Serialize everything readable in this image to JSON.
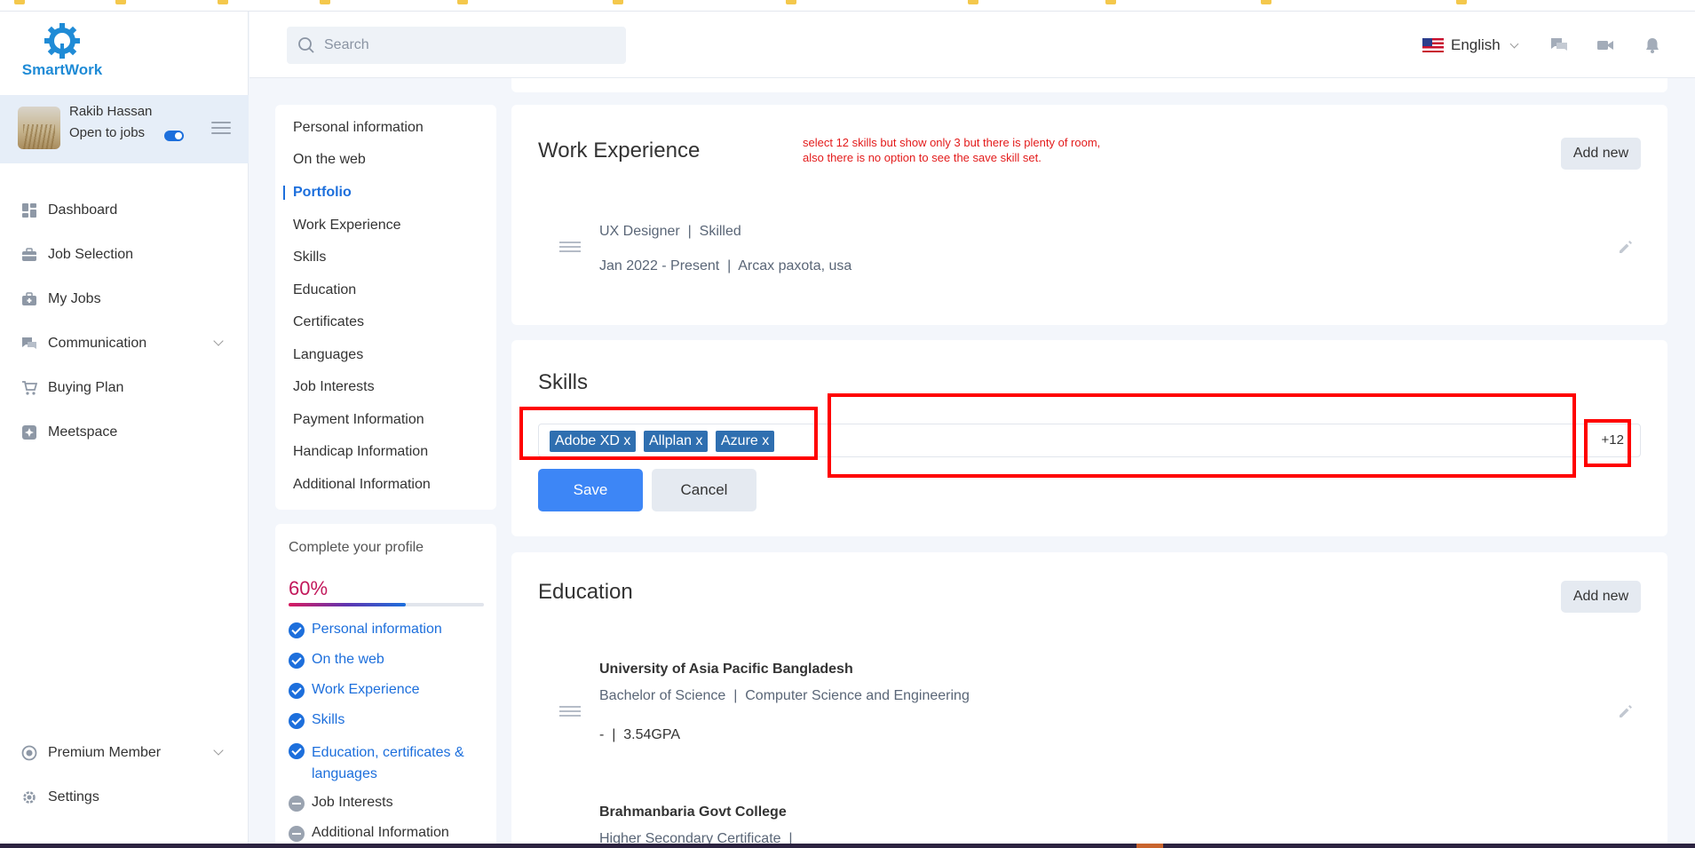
{
  "app": {
    "logo_text": "SmartWork",
    "brand_color": "#1f8bd6",
    "accent_color": "#1d6fdc"
  },
  "user": {
    "name": "Rakib Hassan",
    "status": "Open to jobs",
    "open_to_jobs": true
  },
  "sidebar": {
    "items": [
      {
        "label": "Dashboard",
        "icon": "dashboard-icon"
      },
      {
        "label": "Job Selection",
        "icon": "briefcase-icon"
      },
      {
        "label": "My Jobs",
        "icon": "jobs-bag-icon"
      },
      {
        "label": "Communication",
        "icon": "chat-icon"
      },
      {
        "label": "Buying Plan",
        "icon": "cart-icon"
      },
      {
        "label": "Meetspace",
        "icon": "meetspace-icon"
      }
    ],
    "bottom_items": [
      {
        "label": "Premium Member",
        "icon": "premium-icon"
      },
      {
        "label": "Settings",
        "icon": "gear-icon"
      }
    ]
  },
  "header": {
    "search_placeholder": "Search",
    "language": "English"
  },
  "section_nav": {
    "items": [
      "Personal information",
      "On the web",
      "Portfolio",
      "Work Experience",
      "Skills",
      "Education",
      "Certificates",
      "Languages",
      "Job Interests",
      "Payment Information",
      "Handicap Information",
      "Additional Information"
    ],
    "active": "Portfolio"
  },
  "profile_completion": {
    "title": "Complete your profile",
    "percent_label": "60%",
    "percent": 60,
    "items": [
      {
        "label": "Personal information",
        "done": true
      },
      {
        "label": "On the web",
        "done": true
      },
      {
        "label": "Work Experience",
        "done": true
      },
      {
        "label": "Skills",
        "done": true
      },
      {
        "label": "Education, certificates &",
        "label2": "languages",
        "done": true
      },
      {
        "label": "Job Interests",
        "done": false
      },
      {
        "label": "Additional Information",
        "done": false
      }
    ]
  },
  "work_experience": {
    "title": "Work Experience",
    "add_label": "Add new",
    "entry": {
      "line1": "UX Designer  |  Skilled",
      "line2": "Jan 2022 - Present  |  Arcax paxota, usa"
    }
  },
  "annotation": {
    "line1": "select 12 skills but show only 3 but there is plenty of room,",
    "line2": "also there is no option to see the save skill set."
  },
  "skills": {
    "title": "Skills",
    "chips": [
      "Adobe XD x",
      "Allplan x",
      "Azure x"
    ],
    "more": "+12",
    "save_label": "Save",
    "cancel_label": "Cancel"
  },
  "education": {
    "title": "Education",
    "add_label": "Add new",
    "entries": [
      {
        "school": "University of Asia Pacific Bangladesh",
        "degree": "Bachelor of Science  |  Computer Science and Engineering",
        "detail": "-  |  3.54GPA"
      },
      {
        "school": "Brahmanbaria Govt College",
        "degree": "Higher Secondary Certificate  |"
      }
    ]
  }
}
